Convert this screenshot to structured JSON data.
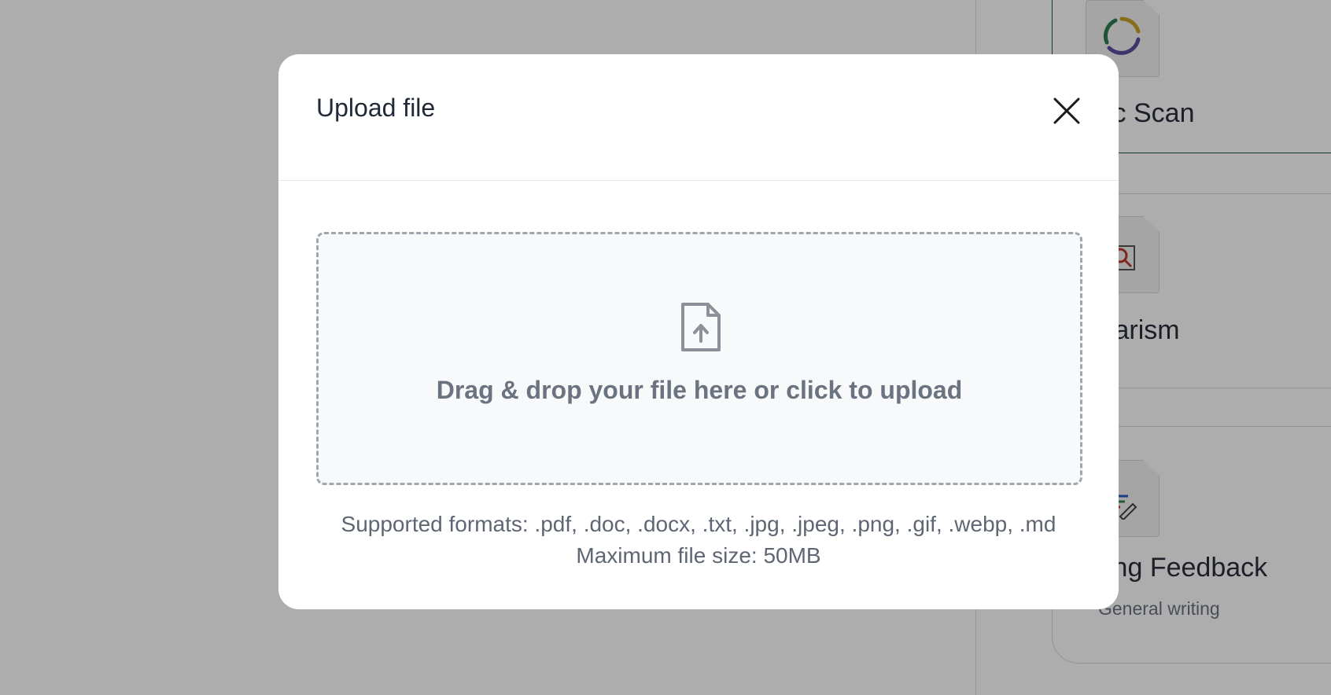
{
  "modal": {
    "title": "Upload file",
    "close_icon": "close-icon",
    "dropzone": {
      "icon": "file-upload-icon",
      "text": "Drag & drop your file here or click to upload"
    },
    "supported_formats": "Supported formats: .pdf, .doc, .docx, .txt, .jpg, .jpeg, .png, .gif, .webp, .md",
    "max_size": "Maximum file size: 50MB"
  },
  "background": {
    "cards": [
      {
        "title": "sic Scan",
        "icon": "progress-ring-icon",
        "selected": true
      },
      {
        "title": "giarism",
        "icon": "plagiarism-search-icon"
      },
      {
        "title": "iting Feedback",
        "subtitle": "General writing",
        "icon": "writing-feedback-icon"
      }
    ]
  },
  "colors": {
    "overlay": "rgba(0,0,0,0.32)",
    "text_dark": "#1f2937",
    "text_muted": "#6b7280",
    "dropzone_border": "#a1a5ad",
    "selected_border": "#1f5a3a"
  }
}
